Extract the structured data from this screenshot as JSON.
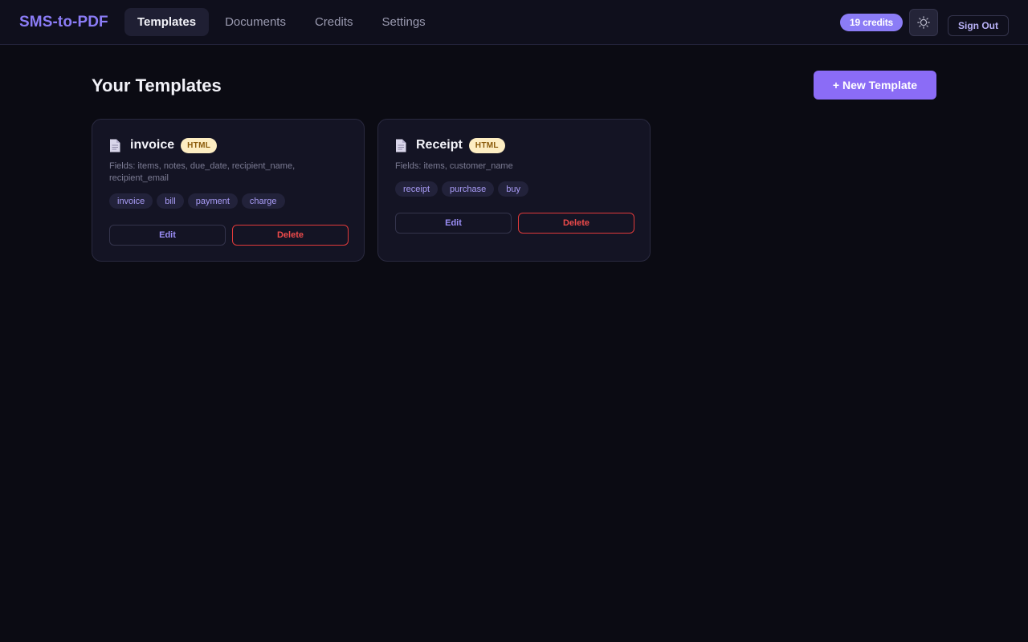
{
  "app": {
    "brand": "SMS-to-PDF",
    "accent_color": "#8b7cf6"
  },
  "nav": {
    "tabs": [
      {
        "label": "Templates",
        "active": true
      },
      {
        "label": "Documents",
        "active": false
      },
      {
        "label": "Credits",
        "active": false
      },
      {
        "label": "Settings",
        "active": false
      }
    ],
    "credits_badge": "19 credits",
    "theme_toggle_icon": "sun-icon",
    "sign_out_label": "Sign Out"
  },
  "main": {
    "title": "Your Templates",
    "new_template_label": "+ New Template",
    "templates": [
      {
        "icon": "document-icon",
        "name": "invoice",
        "format_badge": "HTML",
        "fields_text": "Fields: items, notes, due_date, recipient_name, recipient_email",
        "tags": [
          "invoice",
          "bill",
          "payment",
          "charge"
        ],
        "edit_label": "Edit",
        "delete_label": "Delete"
      },
      {
        "icon": "document-icon",
        "name": "Receipt",
        "format_badge": "HTML",
        "fields_text": "Fields: items, customer_name",
        "tags": [
          "receipt",
          "purchase",
          "buy"
        ],
        "edit_label": "Edit",
        "delete_label": "Delete"
      }
    ]
  },
  "colors": {
    "background": "#0b0b13",
    "card_background": "#141424",
    "badge_background": "#fdedc2",
    "delete_color": "#ef4b4b"
  }
}
